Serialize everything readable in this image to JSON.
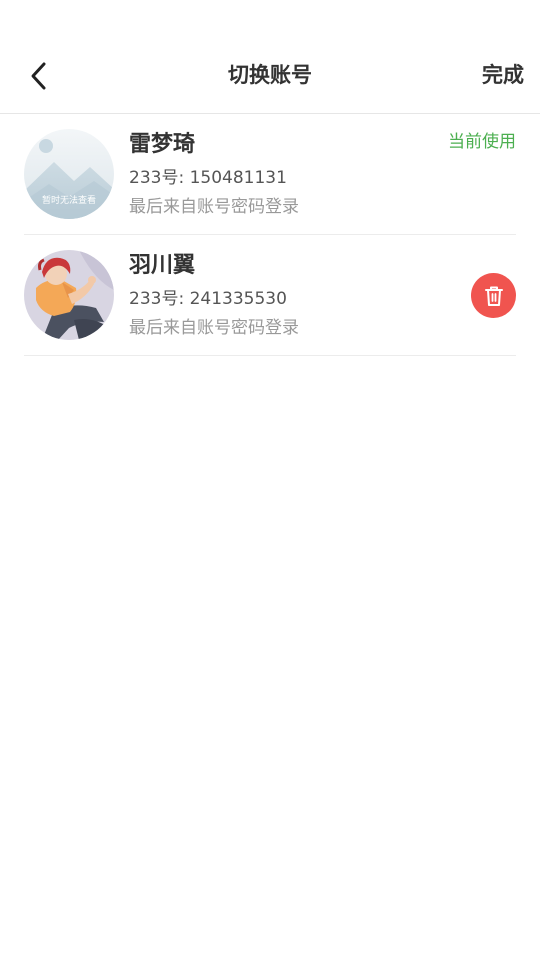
{
  "header": {
    "title": "切换账号",
    "done_label": "完成",
    "back_icon": "chevron-left-icon"
  },
  "accounts": [
    {
      "name": "雷梦琦",
      "uid": "233号: 150481131",
      "login_method": "最后来自账号密码登录",
      "status": "当前使用",
      "avatar_placeholder_text": "暂时无法查看"
    },
    {
      "name": "羽川翼",
      "uid": "233号: 241335530",
      "login_method": "最后来自账号密码登录",
      "action_icon": "trash-icon"
    }
  ],
  "colors": {
    "current_status": "#4caf50",
    "delete_button": "#f0544f",
    "title_text": "#333333",
    "secondary_text": "#999999"
  }
}
